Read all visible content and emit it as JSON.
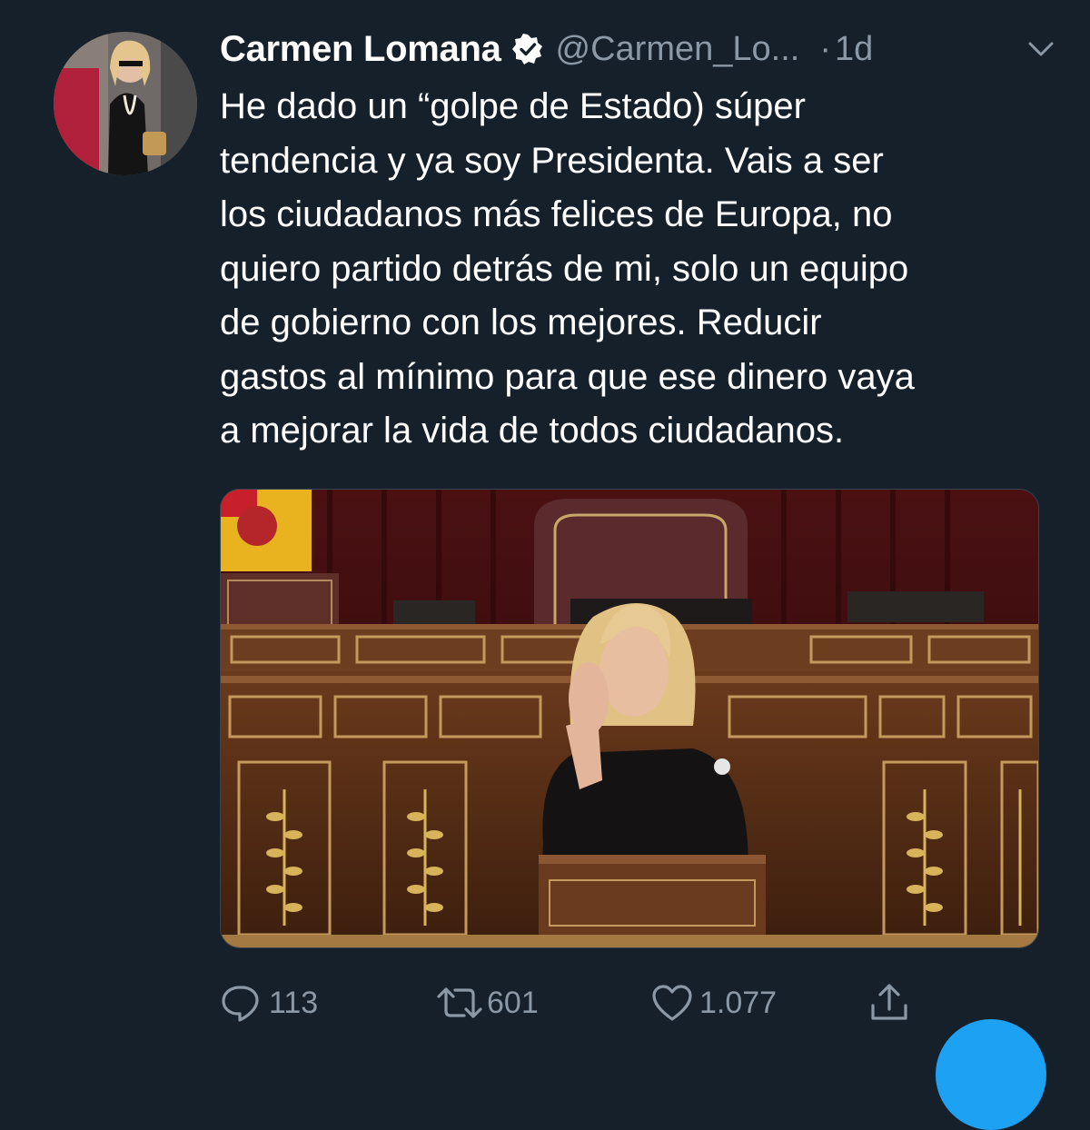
{
  "tweet": {
    "author_name": "Carmen Lomana",
    "author_handle": "@Carmen_Lo...",
    "separator": "·",
    "time": "1d",
    "text": "He dado un “golpe de Estado) súper\ntendencia y ya soy Presidenta. Vais a ser\nlos ciudadanos más felices de Europa, no\nquiero partido detrás de mi, solo un equipo\nde gobierno con los mejores. Reducir\ngastos al mínimo para que ese dinero vaya\na mejorar la vida de todos ciudadanos."
  },
  "icons": {
    "verified": "verified-badge-icon",
    "menu": "chevron-down-icon",
    "reply": "reply-icon",
    "retweet": "retweet-icon",
    "like": "heart-icon",
    "share": "share-icon"
  },
  "actions": {
    "replies": "113",
    "retweets": "601",
    "likes": "1.077"
  },
  "colors": {
    "background": "#15202b",
    "secondary_text": "#8b98a5",
    "accent": "#1da1f2"
  }
}
